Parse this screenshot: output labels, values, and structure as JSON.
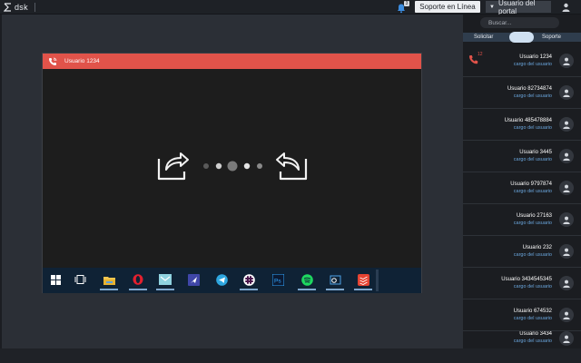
{
  "header": {
    "logo_text": "dsk",
    "notification_count": "3",
    "soporte_button": "Soporte en Línea",
    "portal_user_button": "Usuario del portal"
  },
  "remote_session": {
    "title": "Usuario 1234",
    "header_color": "#e1534a",
    "taskbar_apps": [
      "windows-start-icon",
      "task-view-icon",
      "file-explorer-icon",
      "opera-icon",
      "mail-icon",
      "direct-send-icon",
      "telegram-icon",
      "slack-icon",
      "photoshop-icon",
      "spotify-icon",
      "outlook-icon",
      "todoist-icon"
    ]
  },
  "sidebar": {
    "search_placeholder": "Buscar...",
    "tab_left": "Solicitar",
    "tab_right": "Soporte",
    "accent_color": "#6aa6dd",
    "call_badge": "12",
    "users": [
      {
        "name": "Usuario 1234",
        "role": "cargo del usuario"
      },
      {
        "name": "Usuario 82734874",
        "role": "cargo del usuario"
      },
      {
        "name": "Usuario 485478884",
        "role": "cargo del usuario"
      },
      {
        "name": "Usuario 3445",
        "role": "cargo del usuario"
      },
      {
        "name": "Usuario 9797874",
        "role": "cargo del usuario"
      },
      {
        "name": "Usuario 27163",
        "role": "cargo del usuario"
      },
      {
        "name": "Usuario 232",
        "role": "cargo del usuario"
      },
      {
        "name": "Usuario 3434545345",
        "role": "cargo del usuario"
      },
      {
        "name": "Usuario 674532",
        "role": "cargo del usuario"
      },
      {
        "name": "Usuario 3434",
        "role": "cargo del usuario"
      }
    ]
  }
}
